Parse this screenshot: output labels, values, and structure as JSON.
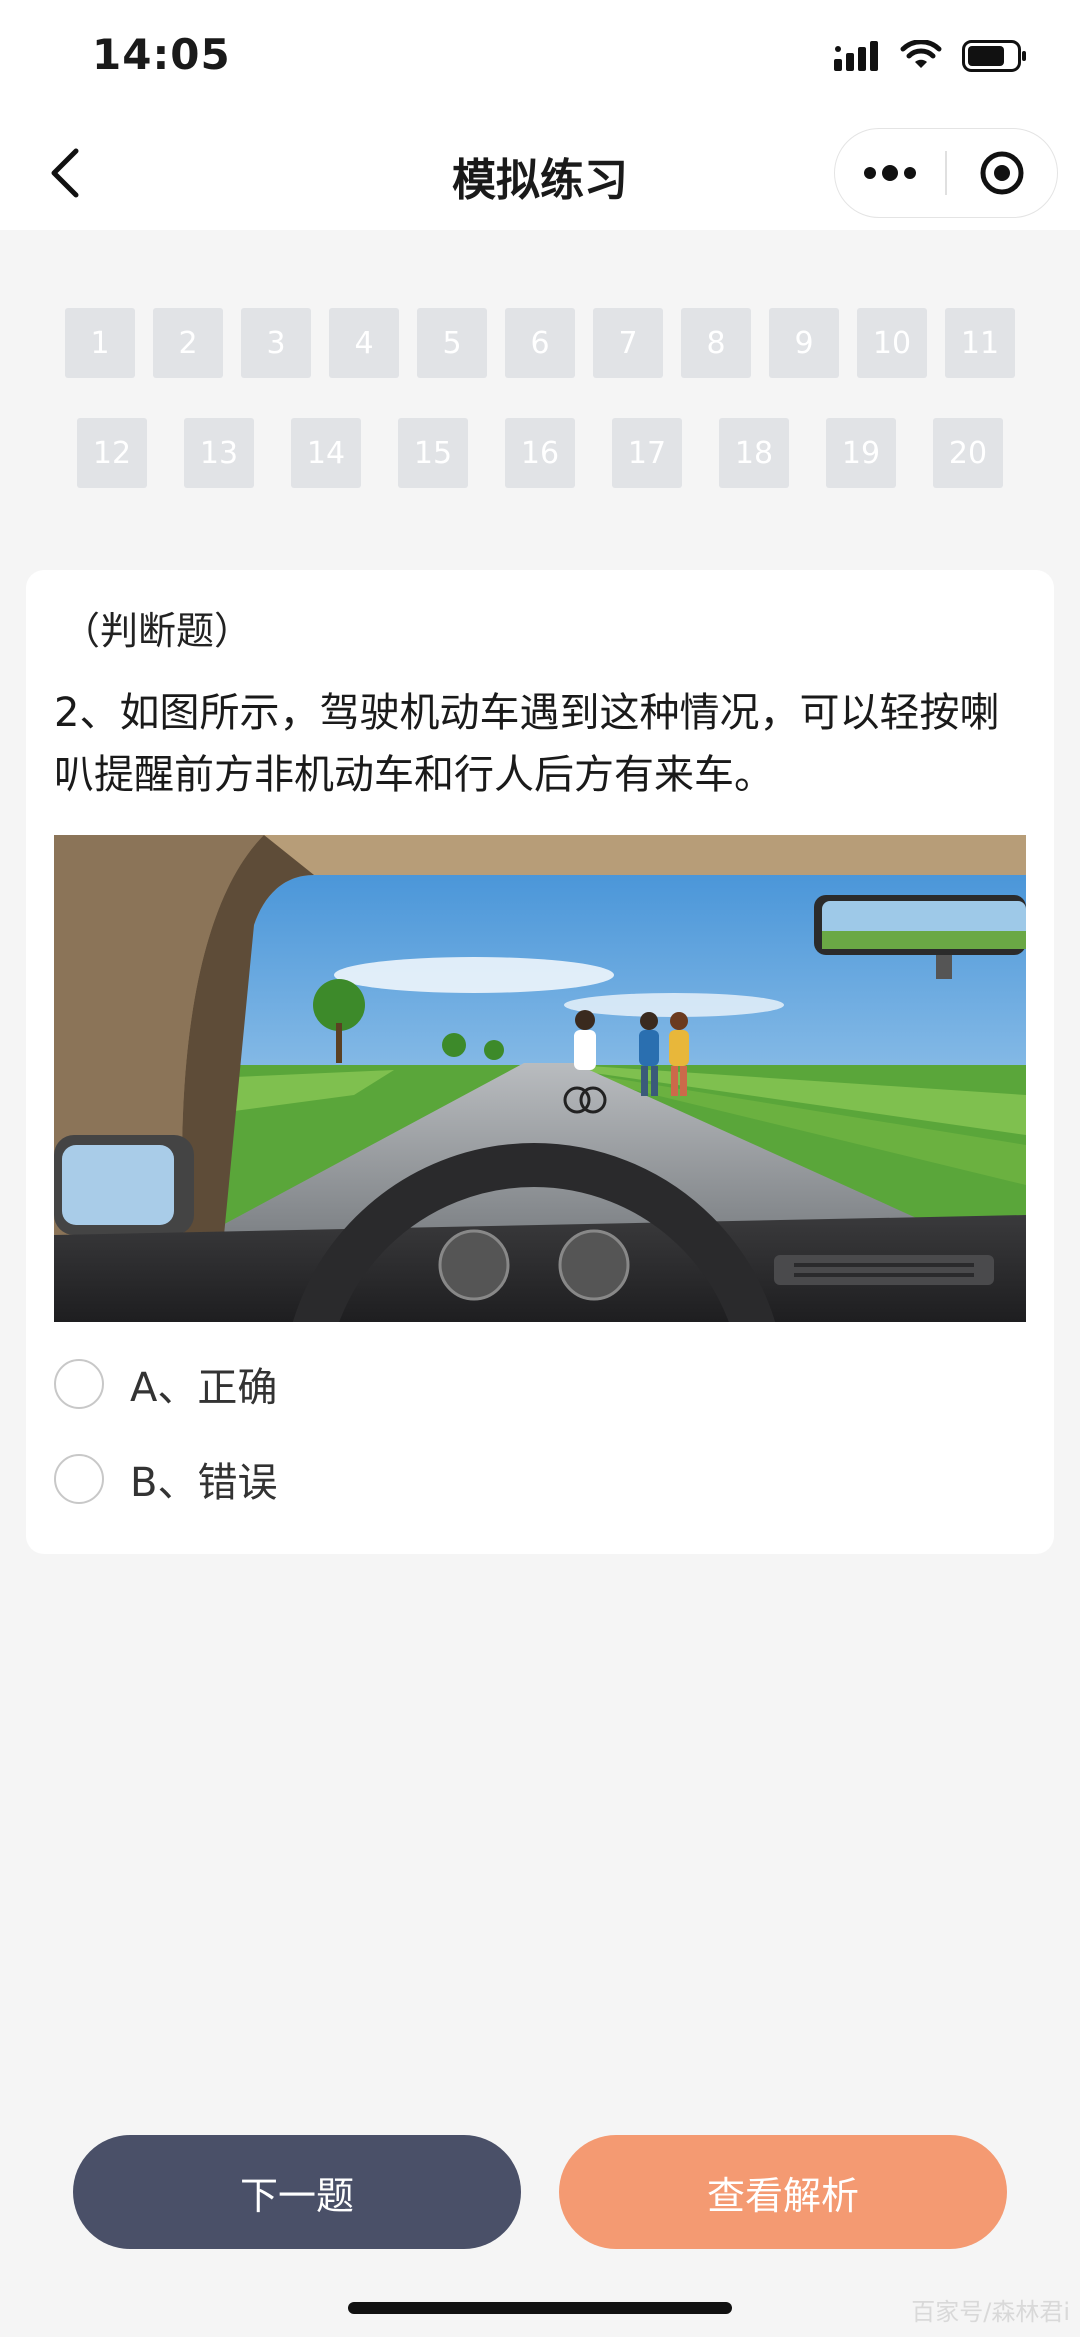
{
  "status_bar": {
    "time": "14:05",
    "icons": [
      "signal-icon",
      "wifi-icon",
      "battery-icon"
    ]
  },
  "nav": {
    "title": "模拟练习",
    "icons": [
      "back-chevron-icon",
      "more-icon",
      "target-icon"
    ]
  },
  "question_numbers": {
    "row1": [
      "1",
      "2",
      "3",
      "4",
      "5",
      "6",
      "7",
      "8",
      "9",
      "10",
      "11"
    ],
    "row2": [
      "12",
      "13",
      "14",
      "15",
      "16",
      "17",
      "18",
      "19",
      "20"
    ]
  },
  "question": {
    "type": "（判断题）",
    "text": "2、如图所示，驾驶机动车遇到这种情况，可以轻按喇叭提醒前方非机动车和行人后方有来车。",
    "options": [
      {
        "label": "A、正确"
      },
      {
        "label": "B、错误"
      }
    ]
  },
  "buttons": {
    "next": "下一题",
    "analysis": "查看解析"
  },
  "watermark": "百家号/森林君i",
  "colors": {
    "next_button": "#4a5068",
    "analysis_button": "#f49a72",
    "number_chip": "#e1e3e6"
  }
}
